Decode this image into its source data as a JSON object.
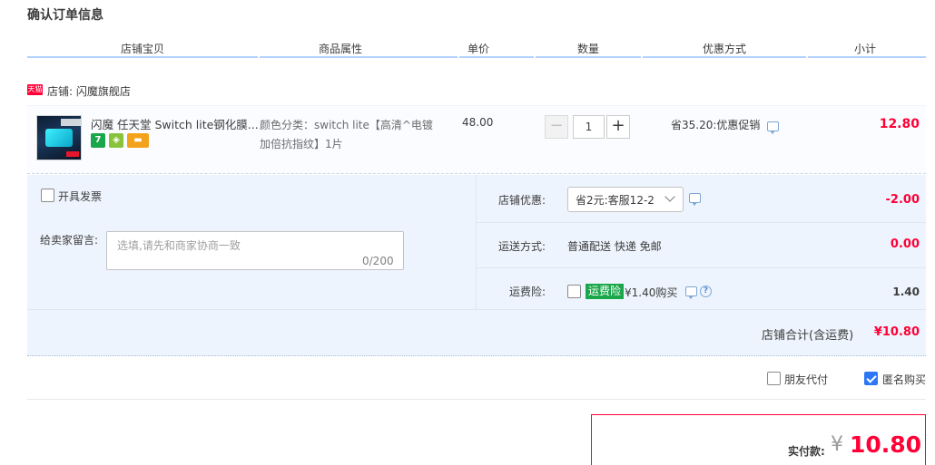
{
  "page_title": "确认订单信息",
  "columns": [
    "店铺宝贝",
    "商品属性",
    "单价",
    "数量",
    "优惠方式",
    "小计"
  ],
  "shop": {
    "badge": "天猫",
    "name": "店铺: 闪魔旗舰店"
  },
  "item": {
    "title": "闪魔 任天堂 Switch lite钢化膜...",
    "services": [
      {
        "label": "7",
        "color": "#1aa64a"
      },
      {
        "label": "◈",
        "color": "#88c33b"
      },
      {
        "label": "▬",
        "color": "#f3a21b"
      }
    ],
    "attr": "颜色分类：switch lite【高清^电镀加倍抗指纹】1片",
    "unit_price": "48.00",
    "quantity": "1",
    "minus": "−",
    "plus": "+",
    "promo": "省35.20:优惠促销",
    "subtotal": "12.80"
  },
  "invoice": {
    "label": "开具发票",
    "checked": false
  },
  "message": {
    "label": "给卖家留言:",
    "placeholder": "选填,请先和商家协商一致",
    "counter": "0/200"
  },
  "shop_discount": {
    "label": "店铺优惠:",
    "selected": "省2元:客服12-2",
    "value": "-2.00"
  },
  "shipping": {
    "label": "运送方式:",
    "method": "普通配送 快递 免邮",
    "value": "0.00"
  },
  "freight_insurance": {
    "label": "运费险:",
    "badge": "运费险",
    "price": "¥1.40购买",
    "value": "1.40",
    "checked": false
  },
  "shop_total": {
    "label": "店铺合计(含运费)",
    "value": "¥10.80"
  },
  "options": {
    "friend_pay": {
      "label": "朋友代付",
      "checked": false
    },
    "anonymous": {
      "label": "匿名购买",
      "checked": true
    }
  },
  "payment": {
    "label": "实付款:",
    "currency": "¥",
    "amount": "10.80"
  },
  "colors": {
    "accent_red": "#ff0036",
    "header_line": "#b2d1ff",
    "panel_bg": "#eef4fd",
    "checkbox_blue": "#2d77f6"
  }
}
